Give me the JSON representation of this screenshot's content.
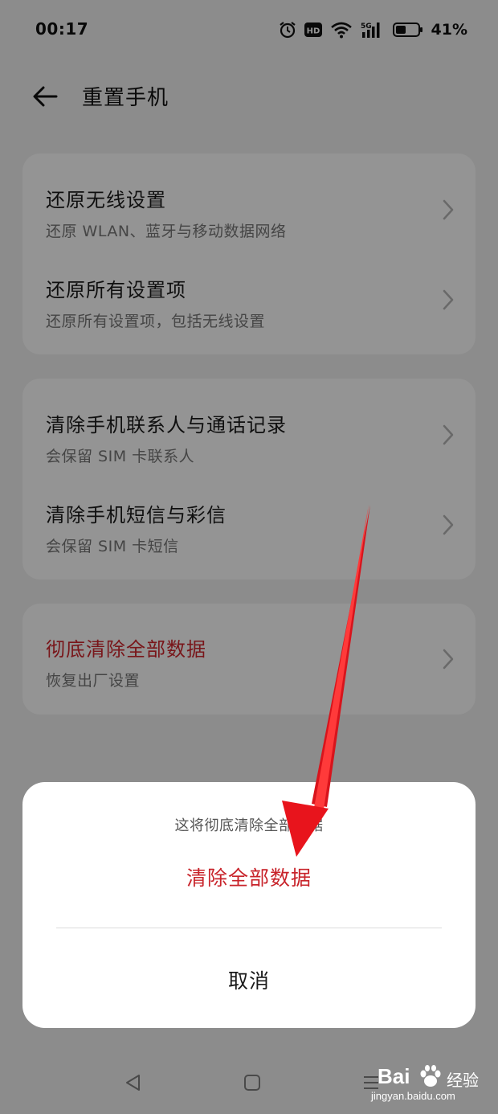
{
  "status_bar": {
    "time": "00:17",
    "battery_percent": "41%",
    "icons": [
      "alarm-icon",
      "hd-icon",
      "wifi-icon",
      "5g-signal-icon",
      "battery-icon"
    ]
  },
  "header": {
    "title": "重置手机",
    "back_icon": "arrow-left-icon"
  },
  "groups": [
    {
      "items": [
        {
          "title": "还原无线设置",
          "subtitle": "还原 WLAN、蓝牙与移动数据网络"
        },
        {
          "title": "还原所有设置项",
          "subtitle": "还原所有设置项，包括无线设置"
        }
      ]
    },
    {
      "items": [
        {
          "title": "清除手机联系人与通话记录",
          "subtitle": "会保留 SIM 卡联系人"
        },
        {
          "title": "清除手机短信与彩信",
          "subtitle": "会保留 SIM 卡短信"
        }
      ]
    },
    {
      "items": [
        {
          "title": "彻底清除全部数据",
          "subtitle": "恢复出厂设置"
        }
      ]
    }
  ],
  "dialog": {
    "message": "这将彻底清除全部数据",
    "confirm_label": "清除全部数据",
    "cancel_label": "取消"
  },
  "nav_bar": {
    "icons": [
      "back-triangle-icon",
      "home-square-icon",
      "menu-lines-icon"
    ]
  },
  "watermark": {
    "brand": "Bai",
    "brand_suffix": "经验",
    "url": "jingyan.baidu.com"
  },
  "colors": {
    "danger": "#d0262d",
    "overlay": "rgba(0,0,0,0.42)",
    "arrow": "#e8141c"
  }
}
